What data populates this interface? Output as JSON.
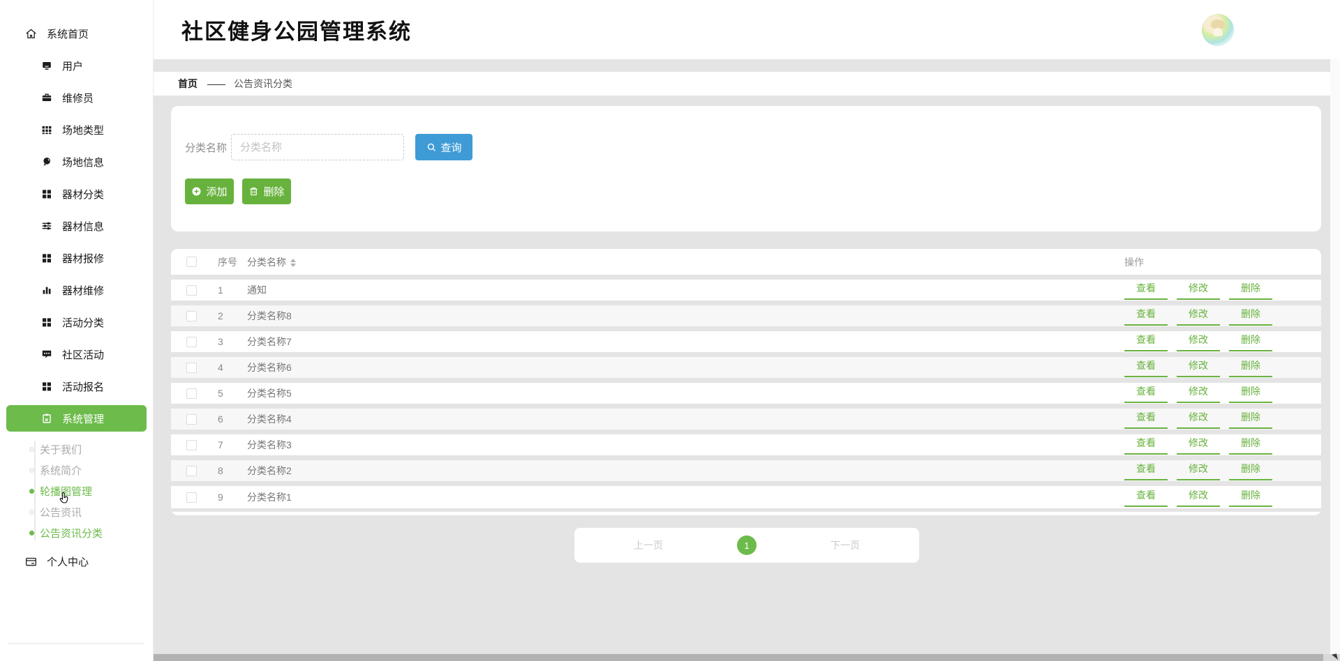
{
  "app_title": "社区健身公园管理系统",
  "sidebar": {
    "items": [
      {
        "label": "系统首页",
        "icon": "home-icon"
      },
      {
        "label": "用户",
        "icon": "monitor-icon"
      },
      {
        "label": "维修员",
        "icon": "briefcase-icon"
      },
      {
        "label": "场地类型",
        "icon": "grid-3x3-icon"
      },
      {
        "label": "场地信息",
        "icon": "location-pin-icon"
      },
      {
        "label": "器材分类",
        "icon": "grid-2x2-icon"
      },
      {
        "label": "器材信息",
        "icon": "sliders-icon"
      },
      {
        "label": "器材报修",
        "icon": "grid-2x2-icon"
      },
      {
        "label": "器材维修",
        "icon": "bar-chart-icon"
      },
      {
        "label": "活动分类",
        "icon": "grid-2x2-icon"
      },
      {
        "label": "社区活动",
        "icon": "chat-bubble-icon"
      },
      {
        "label": "活动报名",
        "icon": "grid-2x2-icon"
      },
      {
        "label": "系统管理",
        "icon": "clipboard-icon",
        "active": true
      }
    ],
    "submenu": [
      {
        "label": "关于我们",
        "active": false
      },
      {
        "label": "系统简介",
        "active": false
      },
      {
        "label": "轮播图管理",
        "active": true
      },
      {
        "label": "公告资讯",
        "active": false
      },
      {
        "label": "公告资讯分类",
        "active": true
      }
    ],
    "personal_center": "个人中心"
  },
  "breadcrumb": {
    "home": "首页",
    "separator": "——",
    "current": "公告资讯分类"
  },
  "search_panel": {
    "label": "分类名称",
    "input_placeholder": "分类名称",
    "input_value": "",
    "query_button": "查询",
    "add_button": "添加",
    "delete_button": "删除"
  },
  "table": {
    "header": {
      "index": "序号",
      "name": "分类名称",
      "actions": "操作"
    },
    "action_labels": [
      "查看",
      "修改",
      "删除"
    ],
    "rows": [
      {
        "index": "1",
        "name": "通知"
      },
      {
        "index": "2",
        "name": "分类名称8"
      },
      {
        "index": "3",
        "name": "分类名称7"
      },
      {
        "index": "4",
        "name": "分类名称6"
      },
      {
        "index": "5",
        "name": "分类名称5"
      },
      {
        "index": "6",
        "name": "分类名称4"
      },
      {
        "index": "7",
        "name": "分类名称3"
      },
      {
        "index": "8",
        "name": "分类名称2"
      },
      {
        "index": "9",
        "name": "分类名称1"
      }
    ]
  },
  "pagination": {
    "prev": "上一页",
    "current_page": "1",
    "next": "下一页"
  },
  "colors": {
    "accent_green": "#6cbb4b",
    "button_green": "#67b23c",
    "accent_blue": "#3f9bd5",
    "page_bg": "#e4e4e4"
  }
}
